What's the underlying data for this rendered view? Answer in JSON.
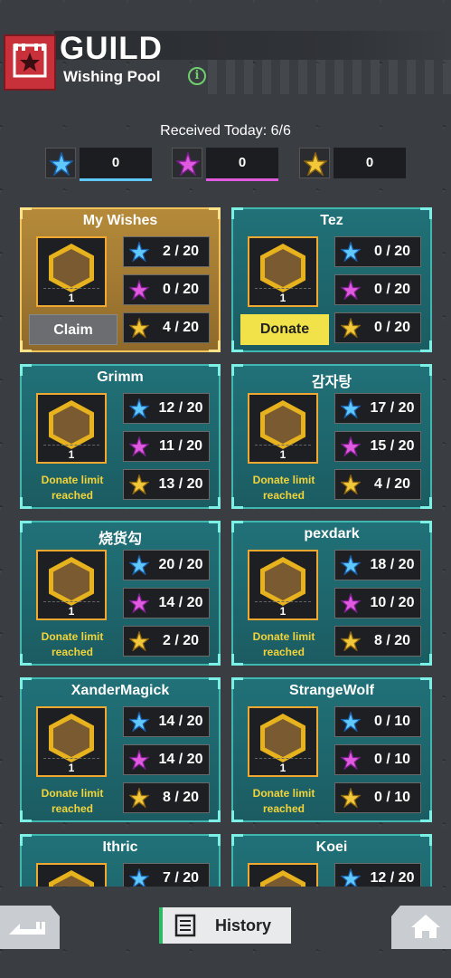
{
  "header": {
    "title": "GUILD",
    "subtitle": "Wishing Pool"
  },
  "received": "Received Today: 6/6",
  "counters": [
    {
      "value": "0",
      "color": "#5fc8ff"
    },
    {
      "value": "0",
      "color": "#e05ae0"
    },
    {
      "value": "0",
      "color": "#f2c83a"
    }
  ],
  "cards": [
    {
      "name": "My Wishes",
      "level": "1",
      "blue": "2 / 20",
      "purple": "0 / 20",
      "gold": "4 / 20",
      "action": "Claim"
    },
    {
      "name": "Tez",
      "level": "1",
      "blue": "0 / 20",
      "purple": "0 / 20",
      "gold": "0 / 20",
      "action": "Donate"
    },
    {
      "name": "Grimm",
      "level": "1",
      "blue": "12 / 20",
      "purple": "11 / 20",
      "gold": "13 / 20",
      "status": "Donate limit reached"
    },
    {
      "name": "감자탕",
      "level": "1",
      "blue": "17 / 20",
      "purple": "15 / 20",
      "gold": "4 / 20",
      "status": "Donate limit reached"
    },
    {
      "name": "烧货勾",
      "level": "1",
      "blue": "20 / 20",
      "purple": "14 / 20",
      "gold": "2 / 20",
      "status": "Donate limit reached"
    },
    {
      "name": "pexdark",
      "level": "1",
      "blue": "18 / 20",
      "purple": "10 / 20",
      "gold": "8 / 20",
      "status": "Donate limit reached"
    },
    {
      "name": "XanderMagick",
      "level": "1",
      "blue": "14 / 20",
      "purple": "14 / 20",
      "gold": "8 / 20",
      "status": "Donate limit reached"
    },
    {
      "name": "StrangeWolf",
      "level": "1",
      "blue": "0 / 10",
      "purple": "0 / 10",
      "gold": "0 / 10",
      "status": "Donate limit reached"
    },
    {
      "name": "Ithric",
      "blue": "7 / 20"
    },
    {
      "name": "Koei",
      "blue": "12 / 20"
    }
  ],
  "footer": {
    "history": "History"
  }
}
